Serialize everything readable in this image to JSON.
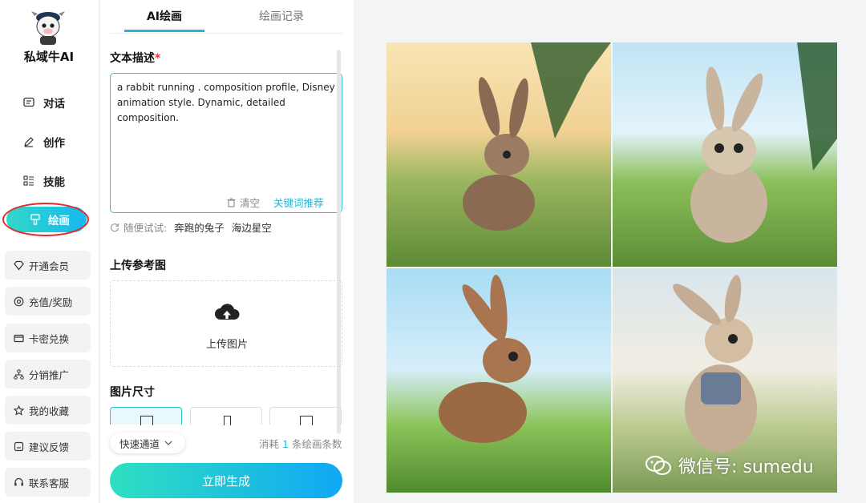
{
  "sidebar": {
    "brand": "私域牛AI",
    "nav": [
      {
        "label": "对话",
        "icon": "chat-icon"
      },
      {
        "label": "创作",
        "icon": "pencil-icon"
      },
      {
        "label": "技能",
        "icon": "list-icon"
      },
      {
        "label": "绘画",
        "icon": "brush-icon",
        "active": true
      }
    ],
    "menu": [
      {
        "label": "开通会员",
        "icon": "diamond-icon"
      },
      {
        "label": "充值/奖励",
        "icon": "coin-icon"
      },
      {
        "label": "卡密兑换",
        "icon": "card-icon"
      },
      {
        "label": "分销推广",
        "icon": "network-icon"
      },
      {
        "label": "我的收藏",
        "icon": "star-icon"
      },
      {
        "label": "建议反馈",
        "icon": "feedback-icon"
      },
      {
        "label": "联系客服",
        "icon": "headset-icon"
      }
    ]
  },
  "panel": {
    "tabs": [
      {
        "label": "AI绘画",
        "active": true
      },
      {
        "label": "绘画记录",
        "active": false
      }
    ],
    "prompt_title": "文本描述",
    "prompt_required": "*",
    "prompt_value": "a rabbit running . composition profile, Disney animation style. Dynamic, detailed composition.",
    "clear_label": "清空",
    "keyword_label": "关键词推荐",
    "suggest_label": "随便试试:",
    "suggest_chips": [
      "奔跑的兔子",
      "海边星空"
    ],
    "upload_title": "上传参考图",
    "upload_label": "上传图片",
    "size_title": "图片尺寸",
    "channel_label": "快速通道",
    "cost_prefix": "消耗",
    "cost_num": "1",
    "cost_suffix": "条绘画条数",
    "generate_label": "立即生成"
  },
  "results": {
    "watermark": "微信号: sumedu"
  },
  "colors": {
    "accent": "#1fb6d8",
    "gradient_start": "#2ee0c0",
    "gradient_end": "#10a8f5",
    "annotation_ring": "#e52b2b"
  }
}
